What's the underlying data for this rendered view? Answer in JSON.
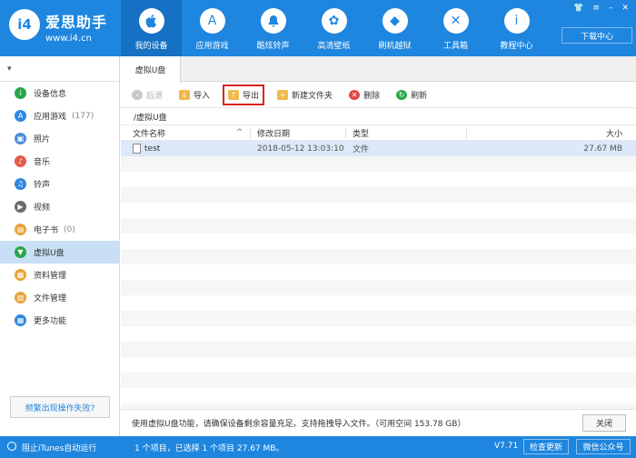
{
  "brand": {
    "logo_text": "i4",
    "name": "爱思助手",
    "url": "www.i4.cn"
  },
  "nav": [
    {
      "label": "我的设备",
      "icon": "apple-icon",
      "glyph": ""
    },
    {
      "label": "应用游戏",
      "icon": "app-store-icon",
      "glyph": "A"
    },
    {
      "label": "酷炫铃声",
      "icon": "bell-icon",
      "glyph": "♪"
    },
    {
      "label": "高清壁纸",
      "icon": "flower-icon",
      "glyph": "✿"
    },
    {
      "label": "刷机越狱",
      "icon": "box-icon",
      "glyph": "◆"
    },
    {
      "label": "工具箱",
      "icon": "tools-icon",
      "glyph": "✕"
    },
    {
      "label": "教程中心",
      "icon": "tutorial-icon",
      "glyph": "i"
    }
  ],
  "window_controls": {
    "shirt": "👕",
    "menu": "≡",
    "minimize": "–",
    "close": "✕"
  },
  "download_center": "下载中心",
  "sidebar": {
    "collapse": "▾",
    "items": [
      {
        "label": "设备信息",
        "count": "",
        "icon": "info-icon",
        "color": "#2aa84a",
        "glyph": "i"
      },
      {
        "label": "应用游戏",
        "count": "(177)",
        "icon": "app-store-icon",
        "color": "#2d88e0",
        "glyph": "A"
      },
      {
        "label": "照片",
        "count": "",
        "icon": "photo-icon",
        "color": "#4a8fd8",
        "glyph": "▣"
      },
      {
        "label": "音乐",
        "count": "",
        "icon": "music-icon",
        "color": "#e65a4a",
        "glyph": "♪"
      },
      {
        "label": "铃声",
        "count": "",
        "icon": "bell-icon",
        "color": "#2d88e0",
        "glyph": "♫"
      },
      {
        "label": "视频",
        "count": "",
        "icon": "video-icon",
        "color": "#6b6b6b",
        "glyph": "▶"
      },
      {
        "label": "电子书",
        "count": "(0)",
        "icon": "book-icon",
        "color": "#e8a33a",
        "glyph": "▤"
      },
      {
        "label": "虚拟U盘",
        "count": "",
        "icon": "usb-icon",
        "color": "#2aa84a",
        "glyph": "▼"
      },
      {
        "label": "资料管理",
        "count": "",
        "icon": "contacts-icon",
        "color": "#e8a33a",
        "glyph": "▦"
      },
      {
        "label": "文件管理",
        "count": "",
        "icon": "file-manager-icon",
        "color": "#e8a33a",
        "glyph": "▥"
      },
      {
        "label": "更多功能",
        "count": "",
        "icon": "more-icon",
        "color": "#2d88e0",
        "glyph": "▦"
      }
    ],
    "active_index": 7,
    "help_button": "频繁出现操作失败?"
  },
  "tab": "虚拟U盘",
  "toolbar": {
    "back": "后退",
    "import": "导入",
    "export": "导出",
    "new_folder": "新建文件夹",
    "delete": "删除",
    "refresh": "刷新"
  },
  "path": "/虚拟U盘",
  "table": {
    "headers": {
      "name": "文件名称",
      "date": "修改日期",
      "type": "类型",
      "size": "大小"
    },
    "sort_arrow": "^",
    "rows": [
      {
        "name": "test",
        "date": "2018-05-12 13:03:10",
        "type": "文件",
        "size": "27.67 MB"
      }
    ]
  },
  "footer_info": "使用虚拟U盘功能，请确保设备剩余容量充足。支持拖拽导入文件。（可用空间 153.78 GB）",
  "close_button": "关闭",
  "status": {
    "itunes": "阻止iTunes自动运行",
    "selection": "1 个项目，已选择 1 个项目 27.67 MB。",
    "version": "V7.71",
    "check_update": "检查更新",
    "wechat": "微信公众号"
  },
  "colors": {
    "primary": "#1e86df",
    "selected_row": "#dbe9f8",
    "highlight_border": "#d9261c"
  }
}
